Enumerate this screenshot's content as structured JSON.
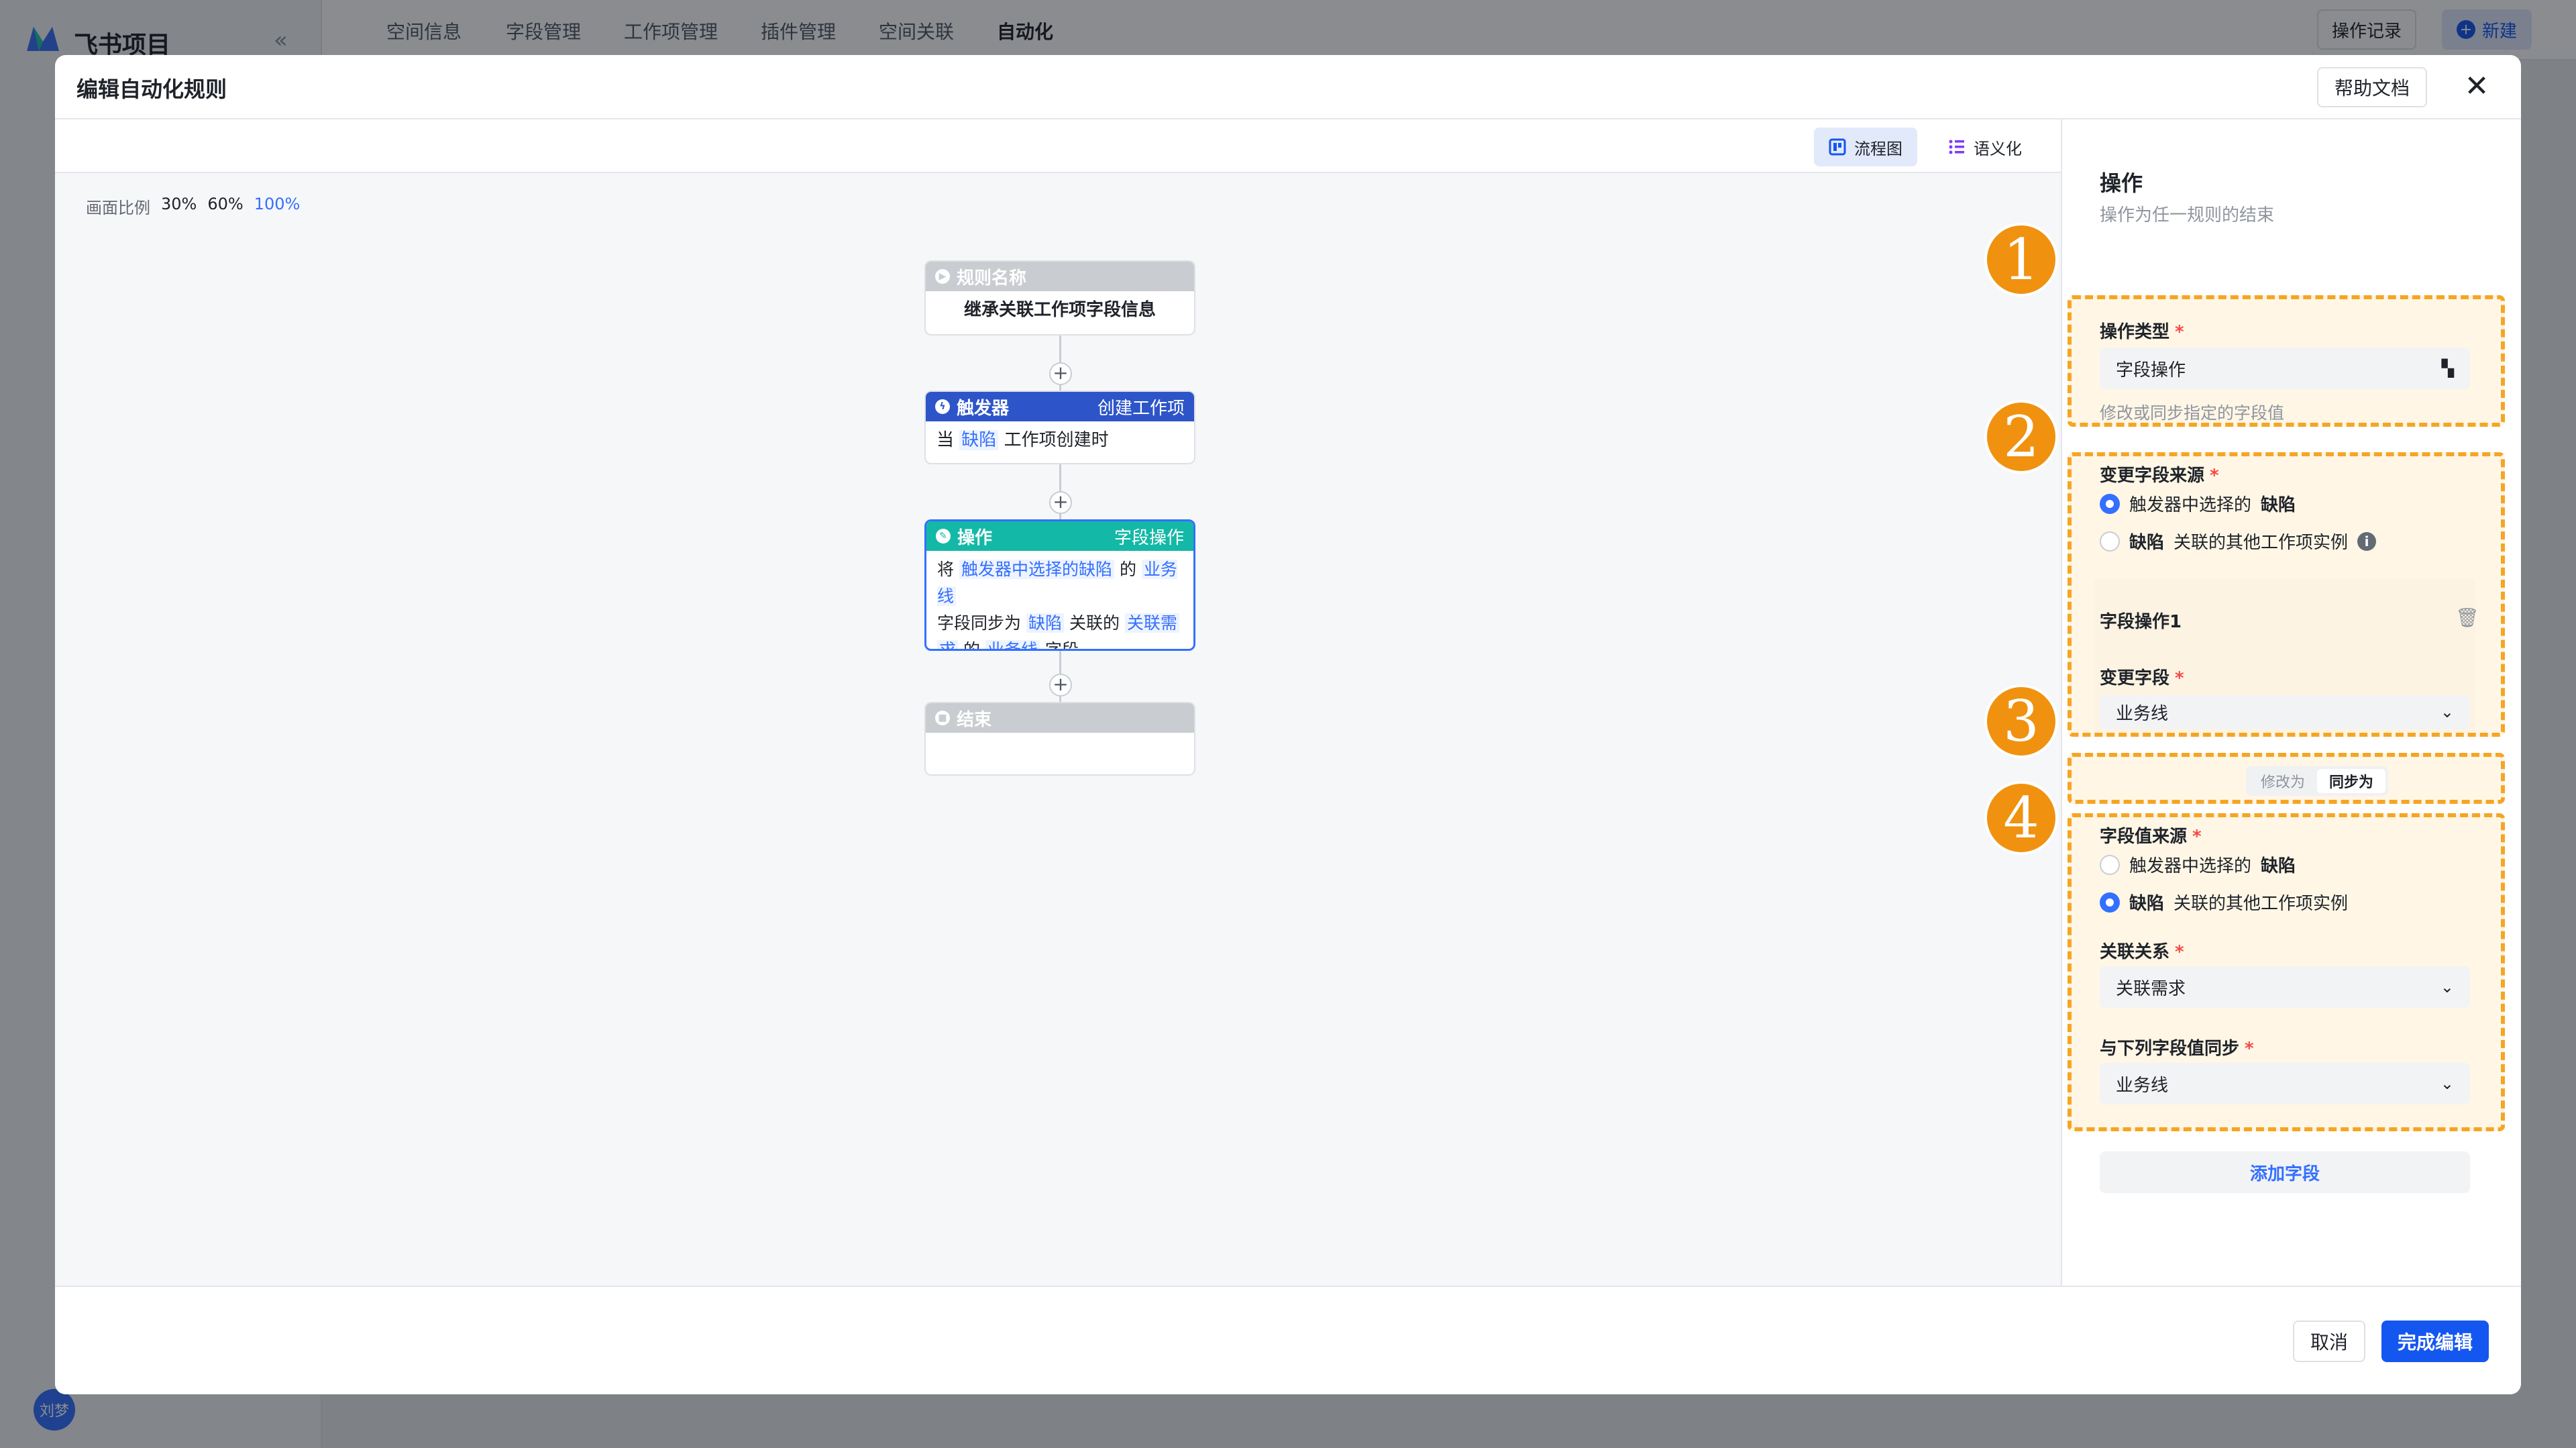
{
  "app": {
    "name": "飞书项目",
    "collapse_icon": "«",
    "user_avatar": "刘梦"
  },
  "top_tabs": [
    {
      "label": "空间信息"
    },
    {
      "label": "字段管理"
    },
    {
      "label": "工作项管理"
    },
    {
      "label": "插件管理"
    },
    {
      "label": "空间关联"
    },
    {
      "label": "自动化"
    }
  ],
  "top_right": {
    "log_label": "操作记录",
    "new_label": "新建"
  },
  "modal": {
    "title": "编辑自动化规则",
    "help_label": "帮助文档",
    "close_label": "✕"
  },
  "view": {
    "flow_label": "流程图",
    "semantic_label": "语义化"
  },
  "zoom": {
    "label": "画面比例",
    "options": [
      "30%",
      "60%",
      "100%"
    ],
    "active": "100%"
  },
  "flow": {
    "rule": {
      "head": "规则名称",
      "body": "继承关联工作项字段信息"
    },
    "trigger": {
      "head": "触发器",
      "tag": "创建工作项",
      "body_pre": "当",
      "body_hl": "缺陷",
      "body_post": "工作项创建时"
    },
    "action": {
      "head": "操作",
      "tag": "字段操作",
      "t1": "将",
      "h1": "触发器中选择的缺陷",
      "t2": "的",
      "h2": "业务线",
      "t3": "字段同步为",
      "h3": "缺陷",
      "t4": "关联的",
      "h4a": "关联需",
      "h4b": "求",
      "t5": "的",
      "h5": "业务线",
      "t6": "字段"
    },
    "end": {
      "head": "结束"
    },
    "plus": "+"
  },
  "panel": {
    "title": "操作",
    "subtitle": "操作为任一规则的结束",
    "op_type_label": "操作类型",
    "op_type_value": "字段操作",
    "op_type_hint": "修改或同步指定的字段值",
    "source_label": "变更字段来源",
    "source_opt1_pre": "触发器中选择的",
    "source_opt1_bold": "缺陷",
    "source_opt2_bold": "缺陷",
    "source_opt2_post": "关联的其他工作项实例",
    "field_op_title": "字段操作1",
    "change_field_label": "变更字段",
    "change_field_value": "业务线",
    "seg_modify": "修改为",
    "seg_sync": "同步为",
    "value_source_label": "字段值来源",
    "value_opt1_pre": "触发器中选择的",
    "value_opt1_bold": "缺陷",
    "value_opt2_bold": "缺陷",
    "value_opt2_post": "关联的其他工作项实例",
    "relation_label": "关联关系",
    "relation_value": "关联需求",
    "sync_label": "与下列字段值同步",
    "sync_value": "业务线",
    "add_field": "添加字段",
    "required": "*"
  },
  "badges": [
    "1",
    "2",
    "3",
    "4"
  ],
  "footer": {
    "cancel": "取消",
    "done": "完成编辑"
  },
  "colors": {
    "trigger_head": "#2d55c9",
    "action_head": "#14b8a6",
    "rule_head": "#c9ccd1",
    "accent": "#1456f0",
    "highlight_border": "#f5a524",
    "badge": "#f0920f"
  }
}
